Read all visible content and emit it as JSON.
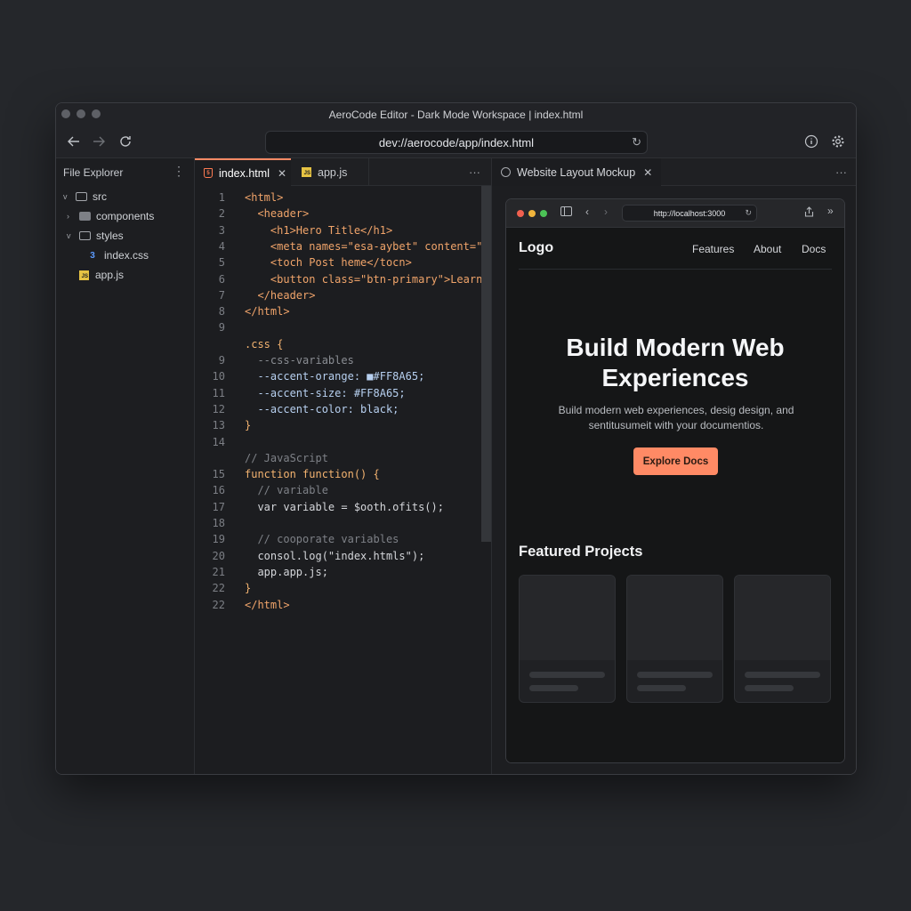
{
  "window": {
    "title": "AeroCode Editor - Dark Mode Workspace | index.html"
  },
  "navbar": {
    "url": "dev://aerocode/app/index.html",
    "back_icon": "arrow-left",
    "forward_icon": "arrow-right",
    "refresh_icon": "refresh",
    "info_icon": "info",
    "settings_icon": "gear"
  },
  "explorer": {
    "title": "File Explorer",
    "items": [
      {
        "label": "src",
        "type": "folder",
        "expanded": true
      },
      {
        "label": "components",
        "type": "folder",
        "expanded": false
      },
      {
        "label": "styles",
        "type": "folder",
        "expanded": true
      },
      {
        "label": "index.css",
        "type": "css"
      },
      {
        "label": "app.js",
        "type": "js"
      }
    ]
  },
  "editor": {
    "tabs": [
      {
        "label": "index.html",
        "active": true
      },
      {
        "label": "app.js",
        "active": false
      }
    ],
    "lines": [
      {
        "n": "1",
        "code": "<html>"
      },
      {
        "n": "2",
        "code": "  <header>"
      },
      {
        "n": "3",
        "code": "    <h1>Hero Title</h1>"
      },
      {
        "n": "4",
        "code": "    <meta names=\"esa-aybet\" content=\"t"
      },
      {
        "n": "5",
        "code": "    <toch Post heme</tocn>"
      },
      {
        "n": "6",
        "code": "    <button class=\"btn-primary\">Learn"
      },
      {
        "n": "7",
        "code": "  </header>"
      },
      {
        "n": "8",
        "code": "</html>"
      },
      {
        "n": "9",
        "code": ""
      },
      {
        "n": "",
        "code": ".css {"
      },
      {
        "n": "9",
        "code": "  --css-variables"
      },
      {
        "n": "10",
        "code": "  --accent-orange: ■#FF8A65;"
      },
      {
        "n": "11",
        "code": "  --accent-size: #FF8A65;"
      },
      {
        "n": "12",
        "code": "  --accent-color: black;"
      },
      {
        "n": "13",
        "code": "}"
      },
      {
        "n": "14",
        "code": ""
      },
      {
        "n": "",
        "code": "// JavaScript"
      },
      {
        "n": "15",
        "code": "function function() {"
      },
      {
        "n": "16",
        "code": "  // variable"
      },
      {
        "n": "17",
        "code": "  var variable = $ooth.ofits();"
      },
      {
        "n": "18",
        "code": ""
      },
      {
        "n": "19",
        "code": "  // cooporate variables"
      },
      {
        "n": "20",
        "code": "  consol.log(\"index.htmls\");"
      },
      {
        "n": "21",
        "code": "  app.app.js;"
      },
      {
        "n": "22",
        "code": "}"
      },
      {
        "n": "22",
        "code": "</html>"
      }
    ]
  },
  "preview": {
    "tab_label": "Website Layout Mockup",
    "browser_url": "http://localhost:3000",
    "site": {
      "logo": "Logo",
      "nav": [
        "Features",
        "About",
        "Docs"
      ],
      "hero_title_line1": "Build Modern Web",
      "hero_title_line2": "Experiences",
      "hero_sub_line1": "Build modern web experiences, desig design, and",
      "hero_sub_line2": "sentitusumeit with your documentios.",
      "cta": "Explore Docs",
      "featured_title": "Featured Projects"
    }
  },
  "colors": {
    "accent": "#FF8A65",
    "background": "#25272b",
    "panel": "#1c1d20"
  }
}
